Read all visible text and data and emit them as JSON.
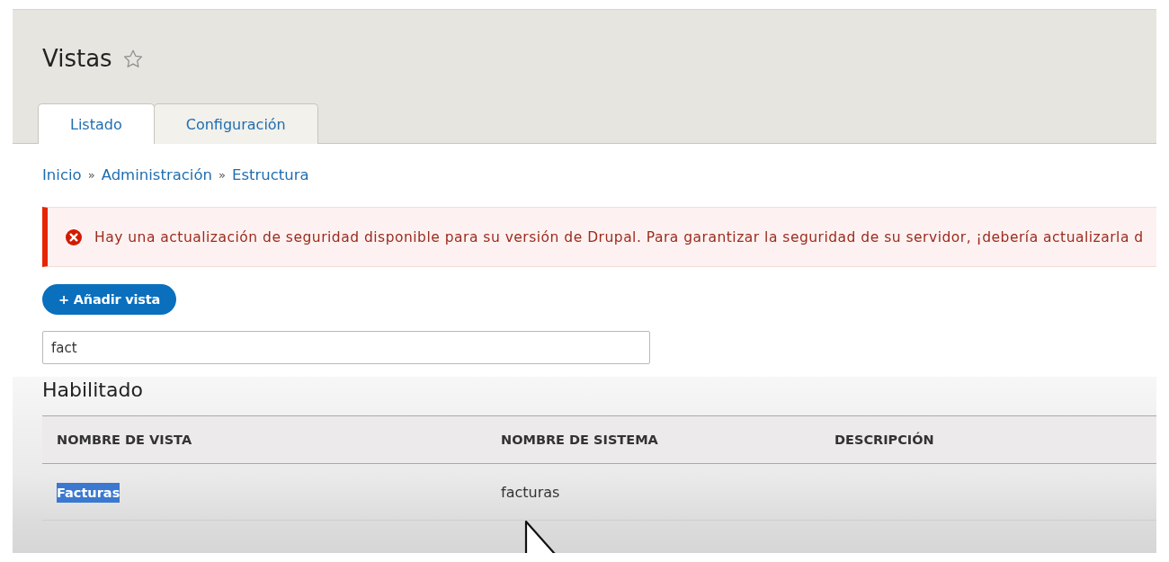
{
  "page": {
    "title": "Vistas",
    "starred": false
  },
  "tabs": [
    {
      "label": "Listado",
      "selected": true
    },
    {
      "label": "Configuración",
      "selected": false
    }
  ],
  "breadcrumb": [
    {
      "label": "Inicio"
    },
    {
      "separator": "»",
      "label": "Administración"
    },
    {
      "separator": "»",
      "label": "Estructura"
    }
  ],
  "message": {
    "kind": "error",
    "text": "Hay una actualización de seguridad disponible para su versión de Drupal. Para garantizar la seguridad de su servidor, ¡debería actualizarla d"
  },
  "add_button": {
    "label": "+ Añadir vista"
  },
  "filter": {
    "value": "fact"
  },
  "section": {
    "title": "Habilitado"
  },
  "table": {
    "columns": [
      "NOMBRE DE VISTA",
      "NOMBRE DE SISTEMA",
      "DESCRIPCIÓN"
    ],
    "rows": [
      {
        "name": "Facturas",
        "name_selected": true,
        "system_name": "facturas"
      }
    ]
  }
}
